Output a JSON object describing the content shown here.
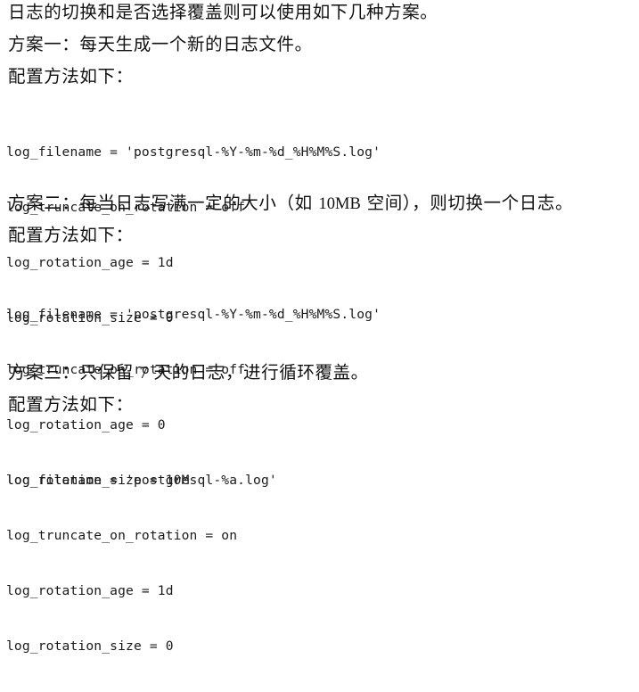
{
  "document": {
    "background_color": "#ffffff",
    "text_color": "#141414",
    "intro_line": "日志的切换和是否选择覆盖则可以使用如下几种方案。",
    "config_label": "配置方法如下："
  },
  "sections": [
    {
      "heading_prefix": "方案一：每天生成一个新的日志文件。",
      "heading_pre": "方案一：每天生成一个新的日志文件。",
      "heading_num": "",
      "heading_post": "",
      "config_label": "配置方法如下：",
      "code": [
        "log_filename = 'postgresql-%Y-%m-%d_%H%M%S.log'",
        "log_truncate_on_rotation = off",
        "log_rotation_age = 1d",
        "log_rotation_size = 0"
      ]
    },
    {
      "heading_prefix": "方案二：每当日志写满一定的大小（如 10MB 空间），则切换一个日志。",
      "heading_pre": "方案二：每当日志写满一定的大小（如 ",
      "heading_num": "10MB",
      "heading_post": " 空间），则切换一个日志。",
      "config_label": "配置方法如下：",
      "code": [
        "log_filename = 'postgresql-%Y-%m-%d_%H%M%S.log'",
        "log_truncate_on_rotation = off",
        "log_rotation_age = 0",
        "log_rotation_size = 10M"
      ]
    },
    {
      "heading_prefix": "方案三：只保留 7 天的日志，进行循环覆盖。",
      "heading_pre": "方案三：只保留 ",
      "heading_num": "7",
      "heading_post": " 天的日志，进行循环覆盖。",
      "config_label": "配置方法如下：",
      "code": [
        "log_filename = 'postgresql-%a.log'",
        "log_truncate_on_rotation = on",
        "log_rotation_age = 1d",
        "log_rotation_size = 0"
      ]
    }
  ]
}
